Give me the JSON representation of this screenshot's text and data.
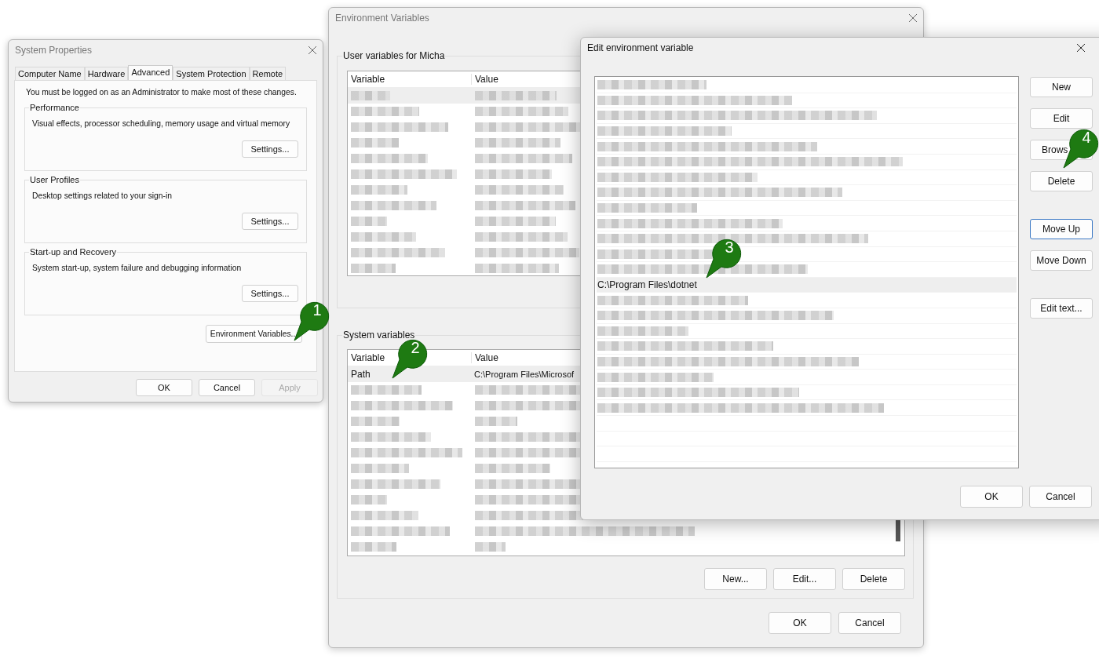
{
  "system_properties": {
    "title": "System Properties",
    "tabs": [
      {
        "label": "Computer Name",
        "selected": false
      },
      {
        "label": "Hardware",
        "selected": false
      },
      {
        "label": "Advanced",
        "selected": true
      },
      {
        "label": "System Protection",
        "selected": false
      },
      {
        "label": "Remote",
        "selected": false
      }
    ],
    "notice": "You must be logged on as an Administrator to make most of these changes.",
    "groups": [
      {
        "title": "Performance",
        "description": "Visual effects, processor scheduling, memory usage and virtual memory",
        "button": "Settings..."
      },
      {
        "title": "User Profiles",
        "description": "Desktop settings related to your sign-in",
        "button": "Settings..."
      },
      {
        "title": "Start-up and Recovery",
        "description": "System start-up, system failure and debugging information",
        "button": "Settings..."
      }
    ],
    "environment_button": "Environment Variables...",
    "buttons": [
      {
        "label": "OK",
        "disabled": false
      },
      {
        "label": "Cancel",
        "disabled": false
      },
      {
        "label": "Apply",
        "disabled": true
      }
    ]
  },
  "environment_variables": {
    "title": "Environment Variables",
    "user_group": {
      "title": "User variables for Micha",
      "columns": [
        "Variable",
        "Value"
      ],
      "rows": [
        {
          "kind": "redacted",
          "selected": true
        },
        {
          "kind": "redacted",
          "selected": false
        },
        {
          "kind": "redacted",
          "selected": false
        },
        {
          "kind": "redacted",
          "selected": false
        },
        {
          "kind": "redacted",
          "selected": false
        },
        {
          "kind": "redacted",
          "selected": false
        },
        {
          "kind": "redacted",
          "selected": false
        },
        {
          "kind": "redacted",
          "selected": false
        },
        {
          "kind": "redacted",
          "selected": false
        },
        {
          "kind": "redacted",
          "selected": false
        },
        {
          "kind": "redacted",
          "selected": false
        },
        {
          "kind": "redacted",
          "selected": false
        }
      ]
    },
    "system_group": {
      "title": "System variables",
      "columns": [
        "Variable",
        "Value"
      ],
      "rows": [
        {
          "kind": "text",
          "variable": "Path",
          "value": "C:\\Program Files\\Microsof",
          "selected": true
        },
        {
          "kind": "redacted",
          "selected": false
        },
        {
          "kind": "redacted",
          "selected": false
        },
        {
          "kind": "redacted",
          "selected": false
        },
        {
          "kind": "redacted",
          "selected": false
        },
        {
          "kind": "redacted",
          "selected": false
        },
        {
          "kind": "redacted",
          "selected": false
        },
        {
          "kind": "redacted",
          "selected": false
        },
        {
          "kind": "redacted",
          "selected": false
        },
        {
          "kind": "redacted",
          "selected": false
        },
        {
          "kind": "redacted",
          "selected": false
        },
        {
          "kind": "redacted",
          "selected": false
        }
      ],
      "buttons": [
        "New...",
        "Edit...",
        "Delete"
      ]
    },
    "buttons": [
      "OK",
      "Cancel"
    ]
  },
  "edit_variable": {
    "title": "Edit environment variable",
    "entries": [
      {
        "kind": "redacted",
        "selected": false
      },
      {
        "kind": "redacted",
        "selected": false
      },
      {
        "kind": "redacted",
        "selected": false
      },
      {
        "kind": "redacted",
        "selected": false
      },
      {
        "kind": "redacted",
        "selected": false
      },
      {
        "kind": "redacted",
        "selected": false
      },
      {
        "kind": "redacted",
        "selected": false
      },
      {
        "kind": "redacted",
        "selected": false
      },
      {
        "kind": "redacted",
        "selected": false
      },
      {
        "kind": "redacted",
        "selected": false
      },
      {
        "kind": "redacted",
        "selected": false
      },
      {
        "kind": "redacted",
        "selected": false
      },
      {
        "kind": "redacted",
        "selected": false
      },
      {
        "kind": "text",
        "text": "C:\\Program Files\\dotnet",
        "selected": true
      },
      {
        "kind": "redacted",
        "selected": false
      },
      {
        "kind": "redacted",
        "selected": false
      },
      {
        "kind": "redacted",
        "selected": false
      },
      {
        "kind": "redacted",
        "selected": false
      },
      {
        "kind": "redacted",
        "selected": false
      },
      {
        "kind": "redacted",
        "selected": false
      },
      {
        "kind": "redacted",
        "selected": false
      },
      {
        "kind": "redacted",
        "selected": false
      }
    ],
    "buttons": [
      {
        "label": "New",
        "focused": false
      },
      {
        "label": "Edit",
        "focused": false
      },
      {
        "label": "Brows",
        "focused": false
      },
      {
        "label": "Delete",
        "focused": false
      },
      {
        "label": "Move Up",
        "focused": true
      },
      {
        "label": "Move Down",
        "focused": false
      },
      {
        "label": "Edit text...",
        "focused": false
      }
    ],
    "bottom_buttons": [
      "OK",
      "Cancel"
    ]
  },
  "callouts": [
    "1",
    "2",
    "3",
    "4"
  ]
}
